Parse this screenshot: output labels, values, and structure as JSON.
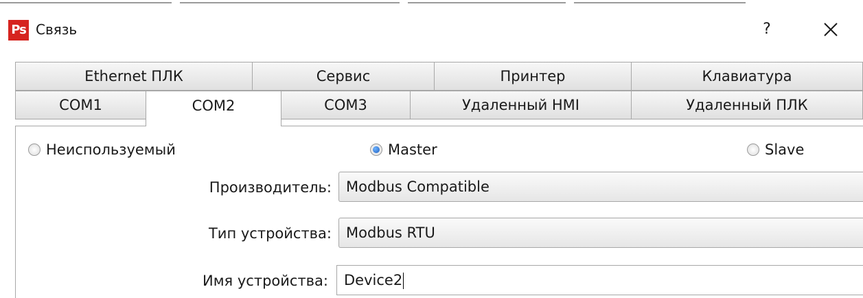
{
  "window": {
    "title": "Связь",
    "app_icon_text": "Ps",
    "help_label": "?",
    "close_icon": "close-icon"
  },
  "tabs_row1": [
    {
      "label": "Ethernet ПЛК"
    },
    {
      "label": "Сервис"
    },
    {
      "label": "Принтер"
    },
    {
      "label": "Клавиатура"
    }
  ],
  "tabs_row2": [
    {
      "label": "COM1"
    },
    {
      "label": "COM2",
      "active": true
    },
    {
      "label": "COM3"
    },
    {
      "label": "Удаленный HMI"
    },
    {
      "label": "Удаленный ПЛК"
    }
  ],
  "mode": {
    "options": [
      "Неиспользуемый",
      "Master",
      "Slave"
    ],
    "selected": "Master"
  },
  "form": {
    "manufacturer_label": "Производитель:",
    "manufacturer_value": "Modbus Compatible",
    "device_type_label": "Тип устройства:",
    "device_type_value": "Modbus RTU",
    "device_name_label": "Имя устройства:",
    "device_name_value": "Device2"
  },
  "colors": {
    "accent_radio": "#1f5fbf",
    "app_icon_bg": "#d6241f"
  }
}
